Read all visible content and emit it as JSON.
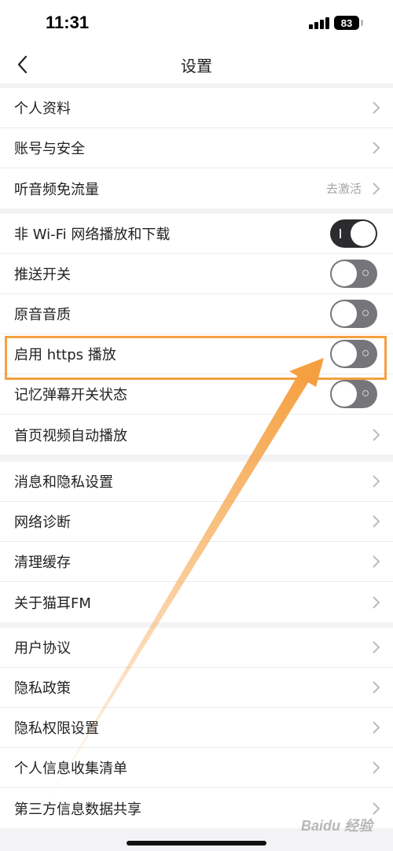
{
  "status_bar": {
    "time": "11:31",
    "battery": "83"
  },
  "header": {
    "title": "设置"
  },
  "groups": [
    {
      "items": [
        {
          "label": "个人资料"
        },
        {
          "label": "账号与安全"
        },
        {
          "label": "听音频免流量",
          "value": "去激活"
        }
      ]
    },
    {
      "items": [
        {
          "label": "非 Wi-Fi 网络播放和下载",
          "toggle_on": true
        },
        {
          "label": "推送开关",
          "toggle_on": false
        },
        {
          "label": "原音音质",
          "toggle_on": false
        },
        {
          "label": "启用 https 播放",
          "toggle_on": false,
          "highlighted": true
        },
        {
          "label": "记忆弹幕开关状态",
          "toggle_on": false
        },
        {
          "label": "首页视频自动播放"
        }
      ]
    },
    {
      "items": [
        {
          "label": "消息和隐私设置"
        },
        {
          "label": "网络诊断"
        },
        {
          "label": "清理缓存"
        },
        {
          "label": "关于猫耳FM"
        }
      ]
    },
    {
      "items": [
        {
          "label": "用户协议"
        },
        {
          "label": "隐私政策"
        },
        {
          "label": "隐私权限设置"
        },
        {
          "label": "个人信息收集清单"
        },
        {
          "label": "第三方信息数据共享"
        }
      ]
    }
  ],
  "annotation": {
    "color": "#f5a040"
  },
  "watermark": {
    "text": "Baidu 经验"
  }
}
